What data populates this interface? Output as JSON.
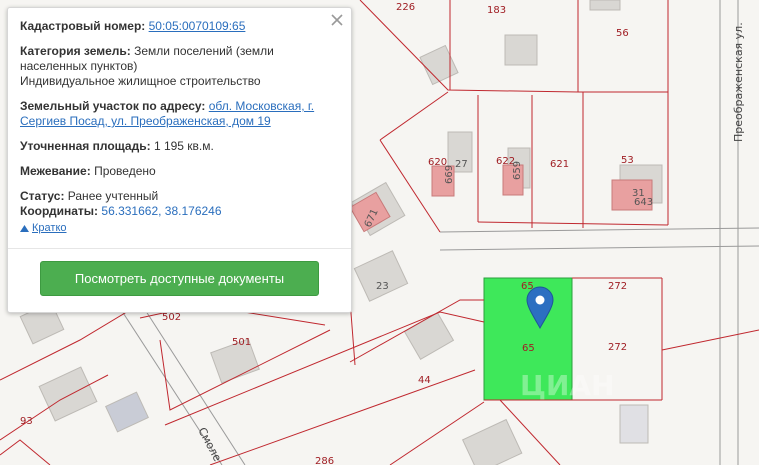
{
  "popup": {
    "cadastral_label": "Кадастровый номер:",
    "cadastral_value": "50:05:0070109:65",
    "category_label": "Категория земель:",
    "category_value": "Земли поселений (земли населенных пунктов)",
    "usage_value": "Индивидуальное жилищное строительство",
    "address_label": "Земельный участок по адресу:",
    "address_value": "обл. Московская, г. Сергиев Посад, ул. Преображенская, дом 19",
    "area_label": "Уточненная площадь:",
    "area_value": "1 195 кв.м.",
    "survey_label": "Межевание:",
    "survey_value": "Проведено",
    "status_label": "Статус:",
    "status_value": "Ранее учтенный",
    "coords_label": "Координаты:",
    "coords_value": "56.331662, 38.176246",
    "collapse_label": "Кратко",
    "docs_button": "Посмотреть доступные документы",
    "close_icon": "close-icon"
  },
  "map": {
    "selected_color": "#3ee85a",
    "boundary_color": "#c0282f",
    "marker_color": "#2c6fc1",
    "plot_numbers": [
      "226",
      "183",
      "56",
      "53",
      "620",
      "622",
      "621",
      "272",
      "272",
      "65",
      "65",
      "501",
      "502",
      "44",
      "93",
      "286"
    ],
    "house_numbers": [
      "27",
      "31",
      "23",
      "671",
      "669",
      "659",
      "643"
    ],
    "streets": [
      "Преображенская ул.",
      "Смоле"
    ],
    "watermark": "ЦИАН"
  }
}
